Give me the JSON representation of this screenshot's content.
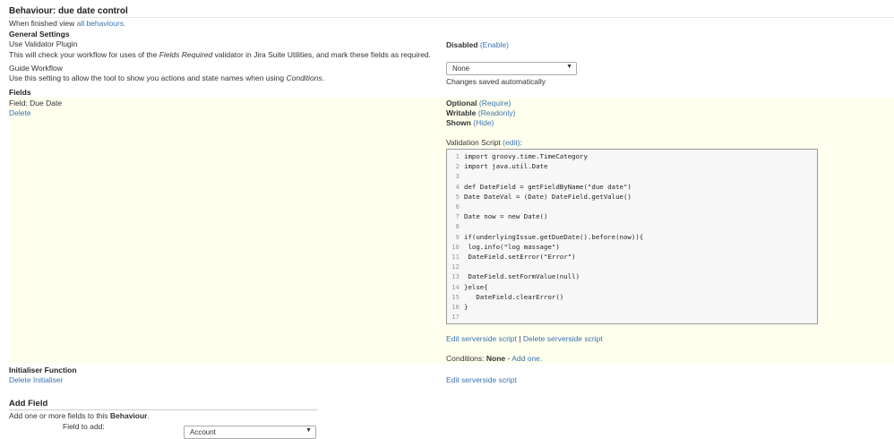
{
  "header": {
    "title": "Behaviour: due date control",
    "finished_prefix": "When finished view ",
    "all_behaviours_link": "all behaviours."
  },
  "general": {
    "heading": "General Settings",
    "validator": {
      "label": "Use Validator Plugin",
      "desc_prefix": "This will check your workflow for uses of the ",
      "desc_em": "Fields Required",
      "desc_suffix": " validator in Jira Suite Utilities, and mark these fields as required.",
      "status": "Disabled",
      "action": "(Enable)"
    },
    "guide": {
      "label": "Guide Workflow",
      "desc_prefix": "Use this setting to allow the tool to show you actions and state names when using ",
      "desc_em": "Conditions",
      "desc_suffix": ".",
      "select_value": "None",
      "saved_note": "Changes saved automatically"
    }
  },
  "fields": {
    "heading": "Fields",
    "field_label": "Field: Due Date",
    "delete_link": "Delete",
    "optional": "Optional",
    "require_link": "(Require)",
    "writable": "Writable",
    "readonly_link": "(Readonly)",
    "shown": "Shown",
    "hide_link": "(Hide)",
    "validation_label": "Validation Script ",
    "edit_link": "(edit)",
    "validation_colon": ":",
    "code_lines": [
      "import groovy.time.TimeCategory",
      "import java.util.Date",
      "",
      "def DateField = getFieldByName(\"due date\")",
      "Date DateVal = (Date) DateField.getValue()",
      "",
      "Date now = new Date()",
      "",
      "if(underlyingIssue.getDueDate().before(now)){",
      " log.info(\"log massage\")",
      " DateField.setError(\"Error\")",
      "",
      " DateField.setFormValue(null)",
      "}else{",
      "   DateField.clearError()",
      "}",
      ""
    ],
    "edit_serverside": "Edit serverside script",
    "separator": " | ",
    "delete_serverside": "Delete serverside script",
    "conditions_label": "Conditions: ",
    "conditions_value": "None",
    "conditions_dash": " - ",
    "add_one": "Add one."
  },
  "initialiser": {
    "heading": "Initialiser Function",
    "delete_link": "Delete Initialiser",
    "edit_serverside": "Edit serverside script"
  },
  "add_field": {
    "heading": "Add Field",
    "desc_prefix": "Add one or more fields to this ",
    "desc_bold": "Behaviour",
    "desc_suffix": ".",
    "field_label": "Field to add:",
    "select_value": "Account"
  }
}
